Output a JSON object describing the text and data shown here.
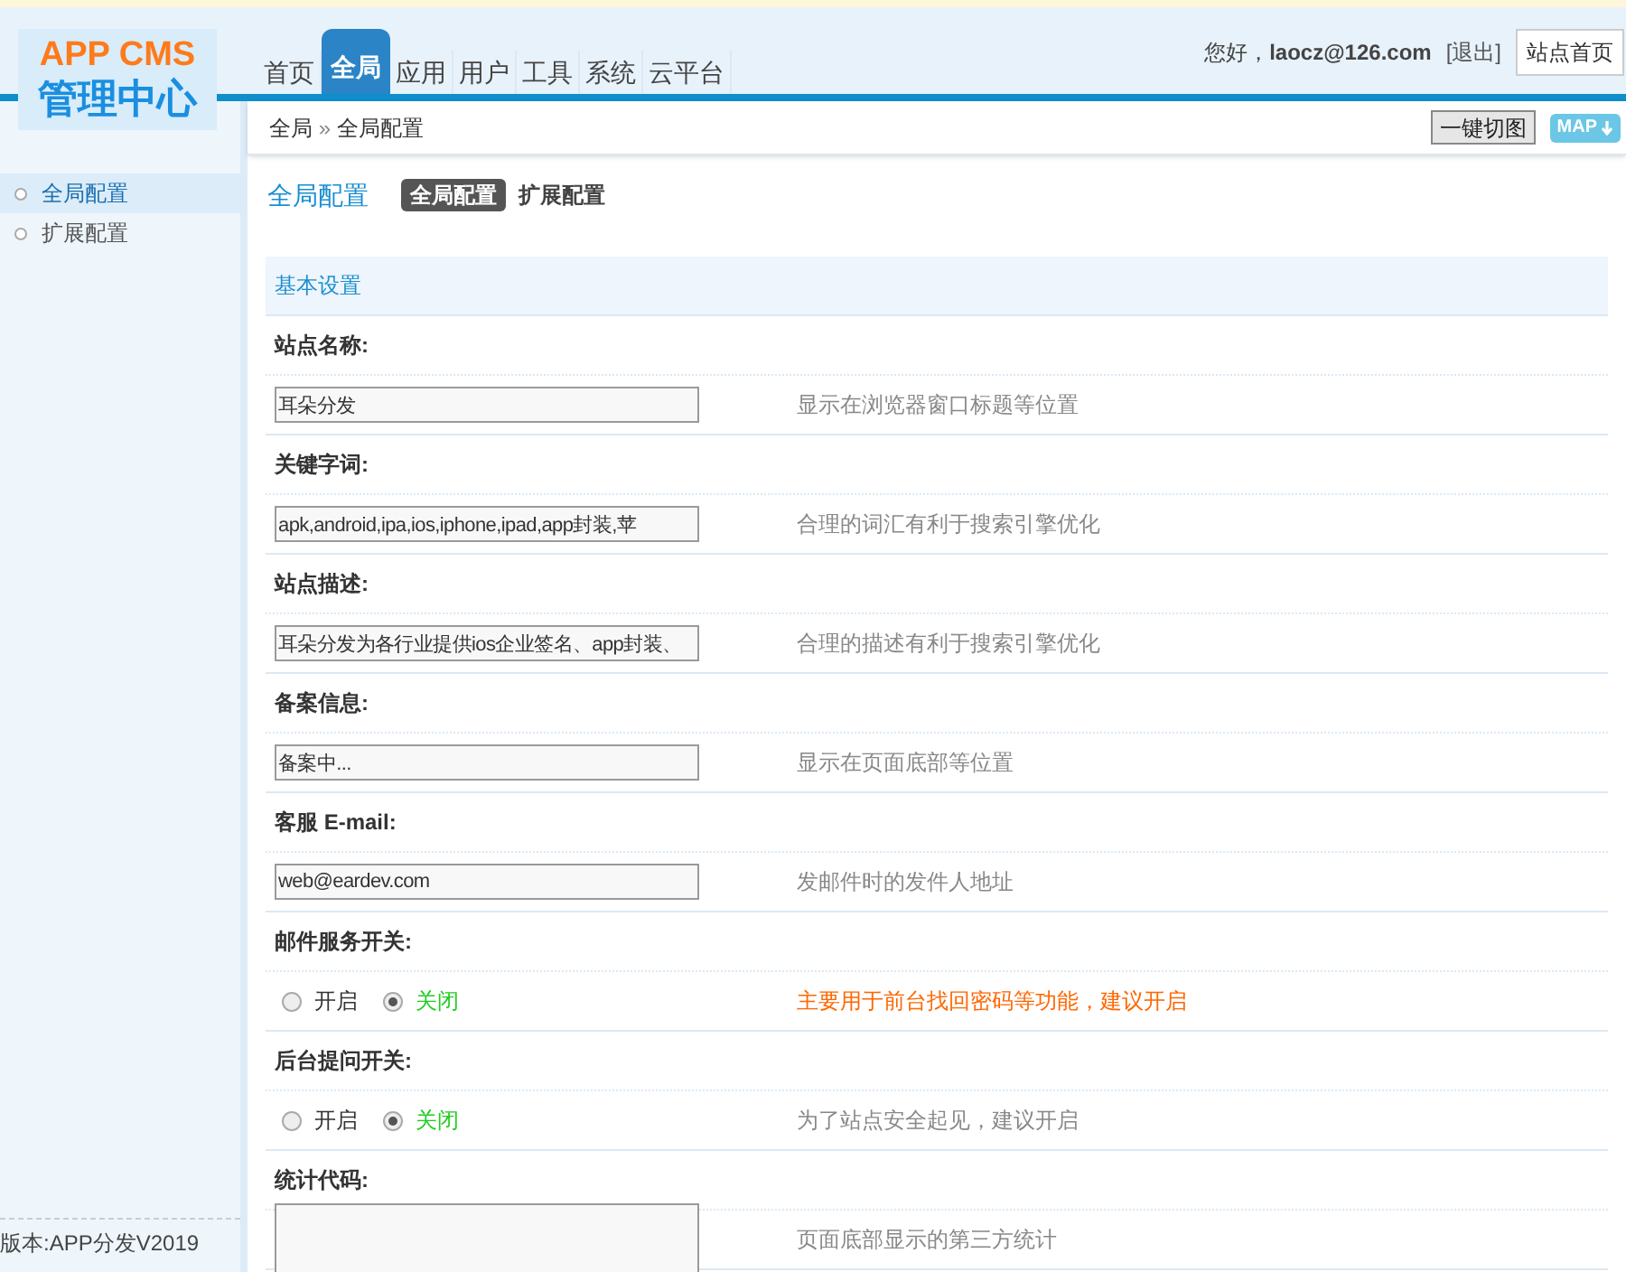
{
  "logo": {
    "title": "APP CMS",
    "subtitle": "管理中心"
  },
  "nav": [
    {
      "label": "首页",
      "selected": false
    },
    {
      "label": "全局",
      "selected": true
    },
    {
      "label": "应用",
      "selected": false
    },
    {
      "label": "用户",
      "selected": false
    },
    {
      "label": "工具",
      "selected": false
    },
    {
      "label": "系统",
      "selected": false
    },
    {
      "label": "云平台",
      "selected": false
    }
  ],
  "user": {
    "greeting": "您好，",
    "account": "laocz@126.com",
    "logout": "[退出]",
    "home_button": "站点首页"
  },
  "breadcrumb": {
    "items": [
      "全局",
      "全局配置"
    ],
    "separator": "»"
  },
  "toolbar": {
    "button": "一键切图",
    "map_button": "MAP"
  },
  "sidebar": {
    "items": [
      {
        "label": "全局配置",
        "selected": true
      },
      {
        "label": "扩展配置",
        "selected": false
      }
    ],
    "footer": "版本:APP分发V2019"
  },
  "page": {
    "title": "全局配置",
    "tabs": [
      {
        "label": "全局配置",
        "selected": true
      },
      {
        "label": "扩展配置",
        "selected": false
      }
    ],
    "section": "基本设置",
    "fields": [
      {
        "kind": "text",
        "label": "站点名称:",
        "value": "耳朵分发",
        "hint": "显示在浏览器窗口标题等位置",
        "warning": false
      },
      {
        "kind": "text",
        "label": "关键字词:",
        "value": "apk,android,ipa,ios,iphone,ipad,app封装,苹",
        "hint": "合理的词汇有利于搜索引擎优化",
        "warning": false
      },
      {
        "kind": "text",
        "label": "站点描述:",
        "value": "耳朵分发为各行业提供ios企业签名、app封装、",
        "hint": "合理的描述有利于搜索引擎优化",
        "warning": false
      },
      {
        "kind": "text",
        "label": "备案信息:",
        "value": "备案中...",
        "hint": "显示在页面底部等位置",
        "warning": false
      },
      {
        "kind": "text",
        "label": "客服 E-mail:",
        "value": "web@eardev.com",
        "hint": "发邮件时的发件人地址",
        "warning": false
      },
      {
        "kind": "radio",
        "label": "邮件服务开关:",
        "options": [
          {
            "label": "开启",
            "selected": false
          },
          {
            "label": "关闭",
            "selected": true
          }
        ],
        "hint": "主要用于前台找回密码等功能，建议开启",
        "warning": true
      },
      {
        "kind": "radio",
        "label": "后台提问开关:",
        "options": [
          {
            "label": "开启",
            "selected": false
          },
          {
            "label": "关闭",
            "selected": true
          }
        ],
        "hint": "为了站点安全起见，建议开启",
        "warning": false
      },
      {
        "kind": "textarea",
        "label": "统计代码:",
        "hint": "页面底部显示的第三方统计",
        "warning": false
      }
    ]
  }
}
